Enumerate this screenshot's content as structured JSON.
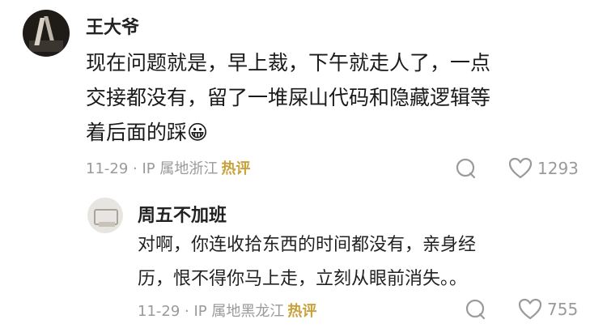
{
  "main_comment": {
    "username": "王大爷",
    "text_lines": [
      "现在问题就是，早上裁，下午就走人了，一点",
      "交接都没有，留了一堆屎山代码和隐藏逻辑等",
      "着后面的踩😀"
    ],
    "meta": "11-29 · IP 属地浙江",
    "hot_label": "热评",
    "likes": "1293"
  },
  "reply_comment": {
    "username": "周五不加班",
    "text_lines": [
      "对啊，你连收拾东西的时间都没有，亲身经",
      "历，恨不得你马上走，立刻从眼前消失。。"
    ],
    "meta": "11-29 · IP 属地黑龙江",
    "hot_label": "热评",
    "likes": "755"
  }
}
